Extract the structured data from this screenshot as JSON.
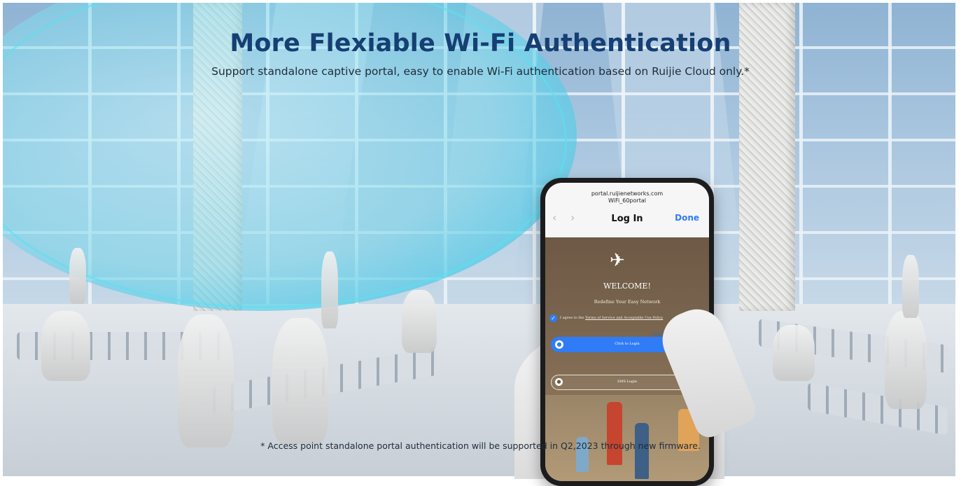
{
  "hero": {
    "title": "More Flexiable Wi-Fi Authentication",
    "subtitle": "Support standalone captive portal, easy to enable Wi-Fi authentication based on Ruijie Cloud only.*",
    "footnote": "* Access point standalone portal authentication will be supported in Q2,2023 through new firmware."
  },
  "phone": {
    "browser": {
      "url": "portal.ruijienetworks.com",
      "ssid": "WiFi_60portal",
      "back_icon": "chevron-left-icon",
      "forward_icon": "chevron-right-icon",
      "title": "Log In",
      "done_label": "Done"
    },
    "portal": {
      "logo_icon": "airplane-icon",
      "welcome": "WELCOME!",
      "tagline": "Redefine Your Easy Network",
      "agree_prefix": "I agree to the ",
      "agree_link": "Terms of Service and Acceptable Use Policy",
      "login_button": "Click to Login",
      "sms_button": "SMS Login"
    }
  },
  "colors": {
    "title": "#163f73",
    "accent": "#2f7cf6",
    "wifi_coverage": "#46c8e6"
  }
}
